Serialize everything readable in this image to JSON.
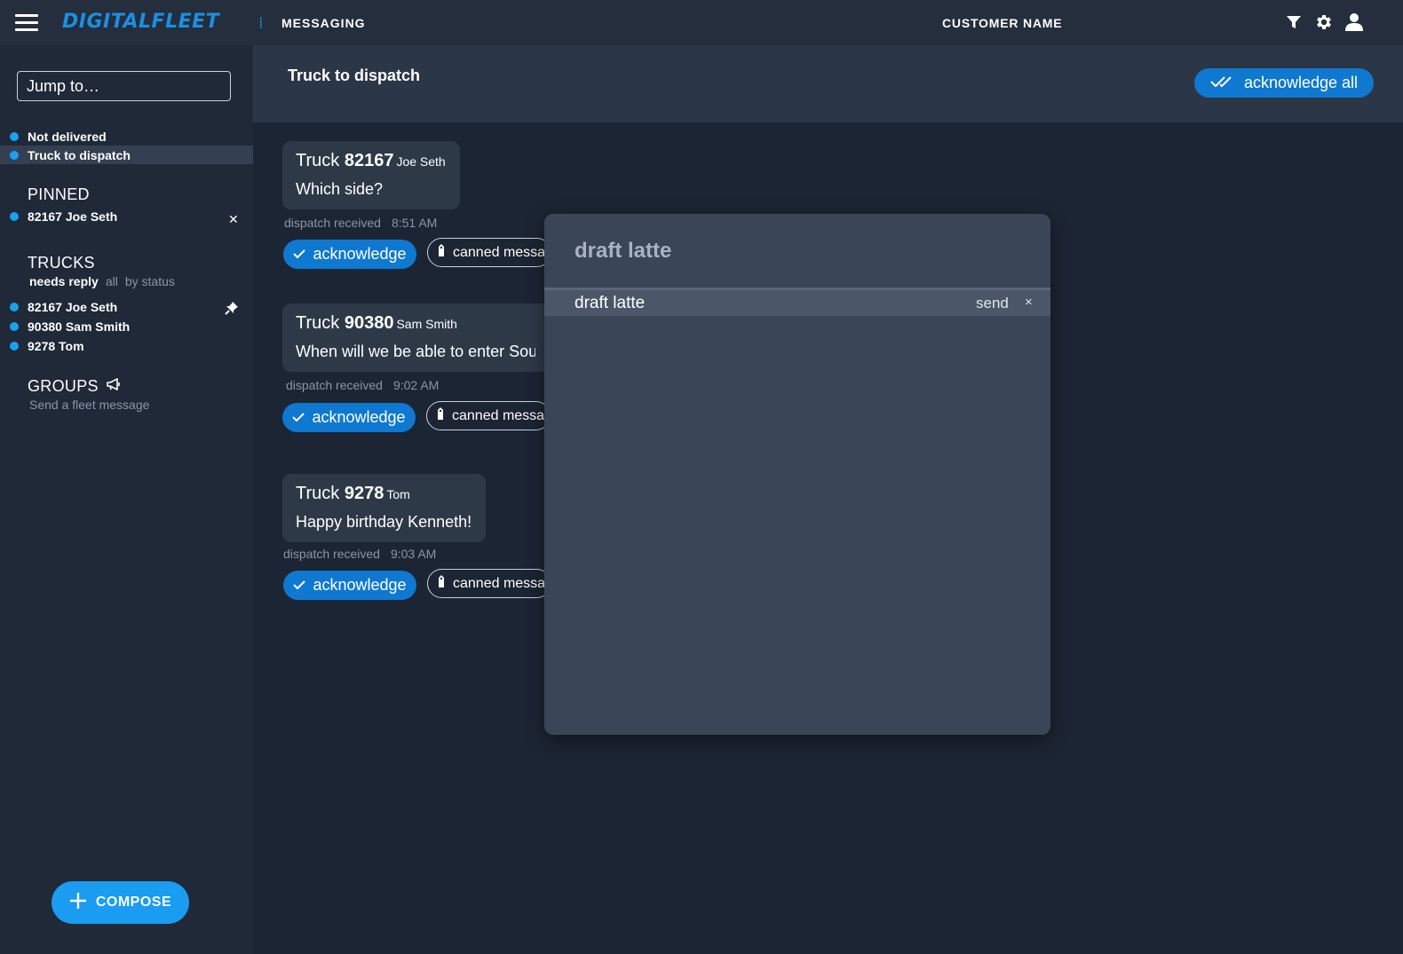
{
  "topbar": {
    "brand": "DIGITALFLEET",
    "separator": "|",
    "section": "MESSAGING",
    "customer": "CUSTOMER NAME"
  },
  "sidebar": {
    "jump_placeholder": "Jump to…",
    "views": [
      {
        "label": "Not delivered"
      },
      {
        "label": "Truck to dispatch",
        "active": true
      }
    ],
    "pinned": {
      "heading": "PINNED",
      "items": [
        {
          "label": "82167 Joe Seth"
        }
      ]
    },
    "trucks": {
      "heading": "TRUCKS",
      "filters": [
        "needs reply",
        "all",
        "by status"
      ],
      "items": [
        {
          "label": "82167 Joe Seth"
        },
        {
          "label": "90380 Sam Smith"
        },
        {
          "label": "9278 Tom"
        }
      ]
    },
    "groups": {
      "heading": "GROUPS",
      "fleet_message": "Send a fleet message"
    },
    "compose_label": "COMPOSE"
  },
  "main": {
    "title": "Truck to dispatch",
    "ack_all_label": "acknowledge all",
    "messages": [
      {
        "prefix": "Truck",
        "truck": "82167",
        "driver": "Joe Seth",
        "text": "Which side?",
        "status": "dispatch received",
        "time": "8:51 AM"
      },
      {
        "prefix": "Truck",
        "truck": "90380",
        "driver": "Sam Smith",
        "text": "When will we be able to enter South",
        "status": "dispatch received",
        "time": "9:02 AM"
      },
      {
        "prefix": "Truck",
        "truck": "9278",
        "driver": "Tom",
        "text": "Happy birthday Kenneth!",
        "status": "dispatch received",
        "time": "9:03 AM"
      }
    ],
    "ack_label": "acknowledge",
    "canned_label": "canned message"
  },
  "modal": {
    "title": "draft latte",
    "row_text": "draft latte",
    "send_label": "send",
    "close_label": "×"
  },
  "colors": {
    "accent": "#1a9cf0",
    "button_blue": "#0f78d0",
    "background": "#1c2533",
    "sidebar": "#1f2938",
    "modal": "#3a4558"
  }
}
